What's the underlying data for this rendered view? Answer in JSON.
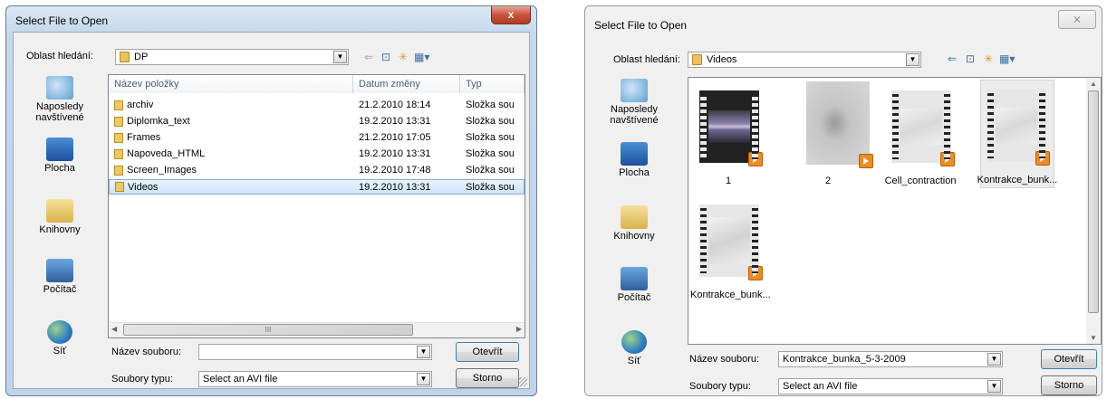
{
  "left_dialog": {
    "title": "Select File to Open",
    "close_label": "x",
    "look_in_label": "Oblast hledání:",
    "look_in_value": "DP",
    "places": [
      {
        "label": "Naposledy navštívené",
        "icon": "recent-places-icon"
      },
      {
        "label": "Plocha",
        "icon": "desktop-icon"
      },
      {
        "label": "Knihovny",
        "icon": "libraries-icon"
      },
      {
        "label": "Počítač",
        "icon": "computer-icon"
      },
      {
        "label": "Síť",
        "icon": "network-icon"
      }
    ],
    "columns": [
      "Název položky",
      "Datum změny",
      "Typ"
    ],
    "rows": [
      {
        "name": "archiv",
        "date": "21.2.2010 18:14",
        "type": "Složka sou"
      },
      {
        "name": "Diplomka_text",
        "date": "19.2.2010 13:31",
        "type": "Složka sou"
      },
      {
        "name": "Frames",
        "date": "21.2.2010 17:05",
        "type": "Složka sou"
      },
      {
        "name": "Napoveda_HTML",
        "date": "19.2.2010 13:31",
        "type": "Složka sou"
      },
      {
        "name": "Screen_Images",
        "date": "19.2.2010 17:48",
        "type": "Složka sou"
      },
      {
        "name": "Videos",
        "date": "19.2.2010 13:31",
        "type": "Složka sou"
      }
    ],
    "selected_row": "Videos",
    "hscroll_glyph": "III",
    "filename_label": "Název souboru:",
    "filename_value": "",
    "filetype_label": "Soubory typu:",
    "filetype_value": "Select an AVI file",
    "open_button": "Otevřít",
    "cancel_button": "Storno"
  },
  "right_dialog": {
    "title": "Select File to Open",
    "close_label": "⨯",
    "look_in_label": "Oblast hledání:",
    "look_in_value": "Videos",
    "places": [
      {
        "label": "Naposledy navštívené",
        "icon": "recent-places-icon"
      },
      {
        "label": "Plocha",
        "icon": "desktop-icon"
      },
      {
        "label": "Knihovny",
        "icon": "libraries-icon"
      },
      {
        "label": "Počítač",
        "icon": "computer-icon"
      },
      {
        "label": "Síť",
        "icon": "network-icon"
      }
    ],
    "tiles": [
      {
        "label": "1"
      },
      {
        "label": "2"
      },
      {
        "label": "Cell_contraction"
      },
      {
        "label": "Kontrakce_bunk..."
      },
      {
        "label": "Kontrakce_bunk..."
      }
    ],
    "filename_label": "Název souboru:",
    "filename_value": "Kontrakce_bunka_5-3-2009",
    "filetype_label": "Soubory typu:",
    "filetype_value": "Select an AVI file",
    "open_button": "Otevřít",
    "cancel_button": "Storno"
  },
  "colors": {
    "selection": "#cce4fb",
    "titlebar": "#c6d8ec",
    "close_button": "#c8523d",
    "folder": "#efc95f",
    "play_badge": "#f08b1f"
  }
}
